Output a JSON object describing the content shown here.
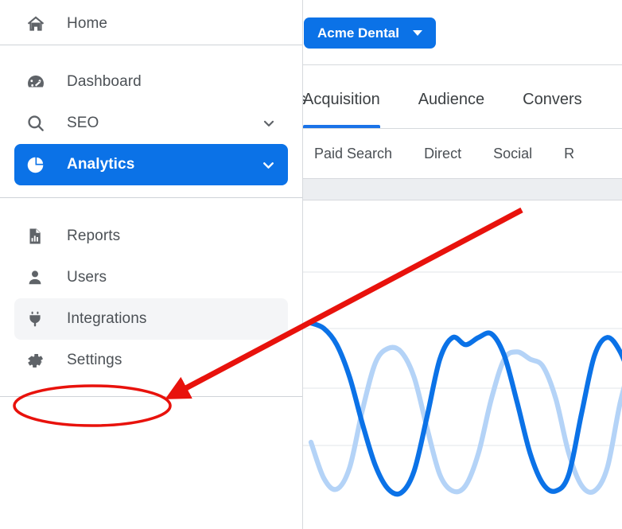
{
  "sidebar": {
    "groups": [
      {
        "items": [
          {
            "label": "Home",
            "icon": "home-icon",
            "state": "default",
            "chevron": false
          }
        ]
      },
      {
        "items": [
          {
            "label": "Dashboard",
            "icon": "speedometer-icon",
            "state": "default",
            "chevron": false
          },
          {
            "label": "SEO",
            "icon": "search-icon",
            "state": "default",
            "chevron": true
          },
          {
            "label": "Analytics",
            "icon": "pie-chart-icon",
            "state": "active",
            "chevron": true
          }
        ]
      },
      {
        "items": [
          {
            "label": "Reports",
            "icon": "report-document-icon",
            "state": "default",
            "chevron": false
          },
          {
            "label": "Users",
            "icon": "person-icon",
            "state": "default",
            "chevron": false
          },
          {
            "label": "Integrations",
            "icon": "power-plug-icon",
            "state": "highlight",
            "chevron": false
          },
          {
            "label": "Settings",
            "icon": "gear-icon",
            "state": "default",
            "chevron": false
          }
        ]
      }
    ]
  },
  "topbar": {
    "org_button_label": "Acme Dental",
    "org_button_caret": "chevron-down-icon"
  },
  "tabs": {
    "clipped_left_label": "s",
    "items": [
      {
        "label": "Acquisition",
        "selected": true
      },
      {
        "label": "Audience",
        "selected": false
      },
      {
        "label": "Convers",
        "selected": false
      }
    ]
  },
  "subtabs": {
    "items": [
      {
        "label": "Paid Search"
      },
      {
        "label": "Direct"
      },
      {
        "label": "Social"
      },
      {
        "label": "R"
      }
    ]
  },
  "colors": {
    "accent": "#0b72e7",
    "tab_underline": "#1a73e8",
    "series_primary": "#0b72e7",
    "series_secondary": "#b4d3f7",
    "annotation": "#e8120c",
    "strip": "#eceef1",
    "divider": "#d6d9dd",
    "sidebar_highlight": "#f4f5f7",
    "text": "#4c5156"
  },
  "annotations": {
    "arrow": {
      "name": "red-arrow-annotation",
      "from_x": 656,
      "from_y": 264,
      "to_x": 226,
      "to_y": 492,
      "color": "#e8120c",
      "width": 7
    },
    "ellipse": {
      "name": "red-ellipse-annotation",
      "cx": 116,
      "cy": 510,
      "rx": 98,
      "ry": 25,
      "color": "#e8120c",
      "width": 3.5,
      "target": "Integrations"
    }
  },
  "chart_data": {
    "type": "line",
    "title": "",
    "xlabel": "",
    "ylabel": "",
    "grid": true,
    "grid_y_positions": [
      372,
      443,
      518,
      590
    ],
    "legend": "none",
    "x": [
      0,
      4,
      8,
      12,
      16,
      20,
      24,
      28,
      32,
      36,
      40,
      44,
      48,
      52,
      56,
      60,
      64,
      68,
      72,
      76,
      80,
      84,
      88,
      92,
      96,
      100
    ],
    "series": [
      {
        "name": "series-primary",
        "color": "#0b72e7",
        "values": [
          96,
          93,
          84,
          66,
          40,
          17,
          4,
          2,
          14,
          44,
          76,
          88,
          84,
          88,
          90,
          78,
          52,
          24,
          7,
          3,
          12,
          46,
          78,
          88,
          80,
          62
        ]
      },
      {
        "name": "series-secondary",
        "color": "#b4d3f7",
        "values": [
          30,
          10,
          4,
          16,
          48,
          74,
          82,
          80,
          66,
          38,
          12,
          3,
          6,
          24,
          54,
          76,
          80,
          76,
          72,
          54,
          24,
          6,
          3,
          16,
          52,
          78
        ]
      }
    ],
    "ylim": [
      0,
      100
    ]
  }
}
